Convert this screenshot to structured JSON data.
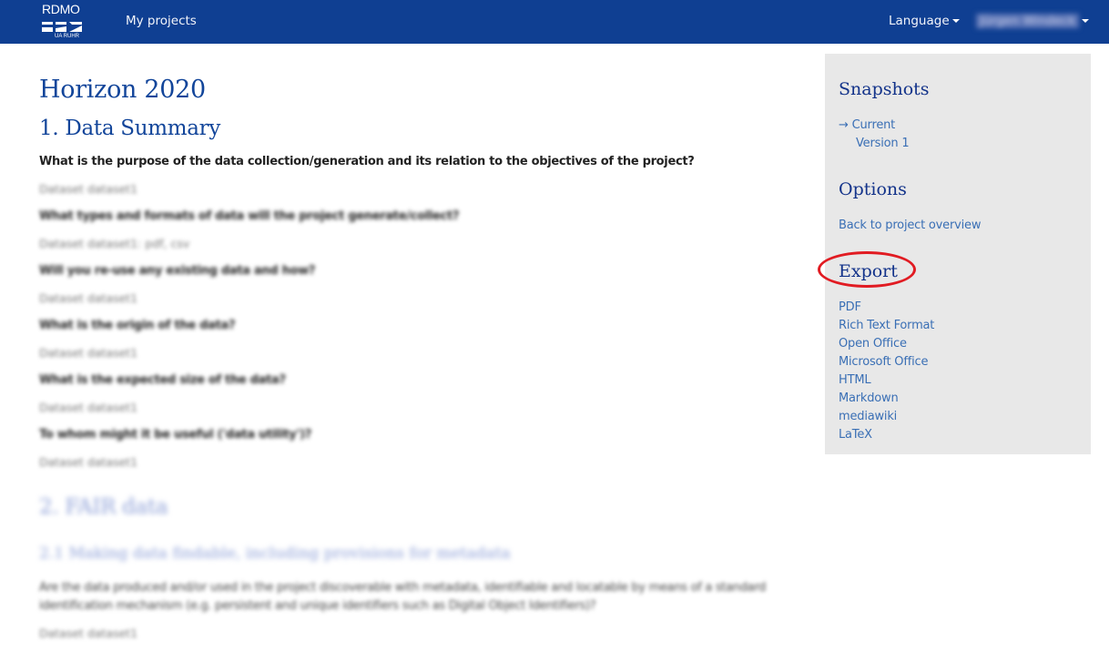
{
  "navbar": {
    "logo": {
      "title": "RDMO",
      "subtitle": "UA RUHR"
    },
    "my_projects": "My projects",
    "language": "Language",
    "user": "Jürgen Windeck"
  },
  "main": {
    "title": "Horizon 2020",
    "sections": [
      {
        "heading": "1. Data Summary",
        "items": [
          {
            "question": "What is the purpose of the data collection/generation and its relation to the objectives of the project?",
            "answer": "Dataset dataset1"
          },
          {
            "question": "What types and formats of data will the project generate/collect?",
            "answer": "Dataset dataset1: pdf, csv"
          },
          {
            "question": "Will you re-use any existing data and how?",
            "answer": "Dataset dataset1"
          },
          {
            "question": "What is the origin of the data?",
            "answer": "Dataset dataset1"
          },
          {
            "question": "What is the expected size of the data?",
            "answer": "Dataset dataset1"
          },
          {
            "question": "To whom might it be useful ('data utility')?",
            "answer": "Dataset dataset1"
          }
        ]
      },
      {
        "heading": "2. FAIR data",
        "subheading": "2.1 Making data findable, including provisions for metadata",
        "items": [
          {
            "question": "Are the data produced and/or used in the project discoverable with metadata, identifiable and locatable by means of a standard identification mechanism (e.g. persistent and unique identifiers such as Digital Object Identifiers)?",
            "answer": "Dataset dataset1"
          }
        ]
      }
    ]
  },
  "sidebar": {
    "snapshots": {
      "heading": "Snapshots",
      "items": [
        {
          "label": "Current",
          "marker": "→",
          "active": true
        },
        {
          "label": "Version 1",
          "marker": "",
          "active": false
        }
      ]
    },
    "options": {
      "heading": "Options",
      "items": [
        {
          "label": "Back to project overview"
        }
      ]
    },
    "export": {
      "heading": "Export",
      "items": [
        {
          "label": "PDF"
        },
        {
          "label": "Rich Text Format"
        },
        {
          "label": "Open Office"
        },
        {
          "label": "Microsoft Office"
        },
        {
          "label": "HTML"
        },
        {
          "label": "Markdown"
        },
        {
          "label": "mediawiki"
        },
        {
          "label": "LaTeX"
        }
      ]
    }
  },
  "annotation": {
    "color": "#e11b22",
    "target": "Export"
  }
}
